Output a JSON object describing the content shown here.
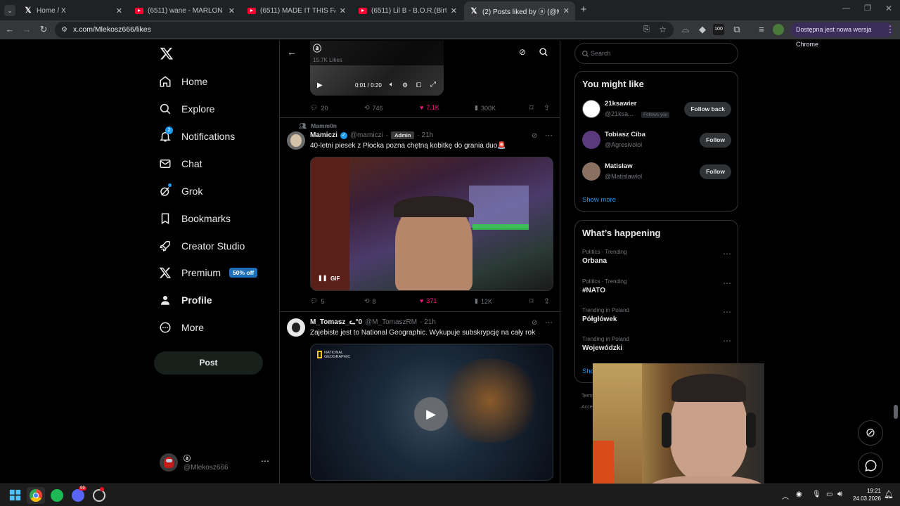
{
  "browser": {
    "tabs": [
      {
        "title": "Home / X",
        "icon": "x-logo"
      },
      {
        "title": "(6511) wane - MARLON BRANDO",
        "icon": "youtube"
      },
      {
        "title": "(6511) MADE IT THIS FAR / ...",
        "icon": "youtube"
      },
      {
        "title": "(6511) Lil B - B.O.R.(Birth Of Rap)",
        "icon": "youtube"
      },
      {
        "title": "(2) Posts liked by ⓐ (@Mlek",
        "icon": "x-logo",
        "active": true
      }
    ],
    "url": "x.com/Mlekosz666/likes",
    "update_label": "Dostępna jest nowa wersja Chrome",
    "extension_badge": "100"
  },
  "nav": {
    "items": [
      {
        "label": "Home",
        "icon": "home-icon"
      },
      {
        "label": "Explore",
        "icon": "search-icon"
      },
      {
        "label": "Notifications",
        "icon": "bell-icon",
        "badge": "2"
      },
      {
        "label": "Chat",
        "icon": "mail-icon"
      },
      {
        "label": "Grok",
        "icon": "grok-icon"
      },
      {
        "label": "Bookmarks",
        "icon": "bookmark-icon"
      },
      {
        "label": "Creator Studio",
        "icon": "rocket-icon"
      },
      {
        "label": "Premium",
        "icon": "x-logo-icon",
        "badge": "50% off"
      },
      {
        "label": "Profile",
        "icon": "person-icon"
      },
      {
        "label": "More",
        "icon": "more-circle-icon"
      }
    ],
    "post_label": "Post",
    "account": {
      "name": "ⓐ",
      "handle": "@Mlekosz666"
    }
  },
  "header": {
    "name": "ⓐ",
    "subtitle": "15.7K Likes"
  },
  "video_controls": {
    "time": "0:01 / 0:20"
  },
  "tweet0": {
    "replies": "20",
    "reposts": "746",
    "likes": "7.1K",
    "views": "300K"
  },
  "tweet1": {
    "context": "Mamm0n",
    "name": "Mamiczi",
    "handle": "@mamiczi",
    "badge": "Admin",
    "time": "· 21h",
    "text": "40-letni piesek z Płocka pozna chętną kobitkę do grania duo🚨",
    "media_tag": "GIF",
    "replies": "5",
    "reposts": "8",
    "likes": "371",
    "views": "12K"
  },
  "tweet2": {
    "name": "M_Tomasz_ᓚ°0",
    "handle": "@M_TomaszRM",
    "time": "· 21h",
    "text": "Zajebiste jest to National Geographic. Wykupuje subskrypcję na cały rok",
    "media_brand": "NATIONAL GEOGRAPHIC"
  },
  "search": {
    "placeholder": "Search"
  },
  "you_might_like": {
    "title": "You might like",
    "users": [
      {
        "name": "21ksawier",
        "handle": "@21ksa...",
        "note": "Follows you",
        "button": "Follow back"
      },
      {
        "name": "Tobiasz Ciba",
        "handle": "@Agresivolol",
        "button": "Follow"
      },
      {
        "name": "Matislaw",
        "handle": "@Matislawlol",
        "button": "Follow"
      }
    ],
    "show_more": "Show more"
  },
  "whats_happening": {
    "title": "What’s happening",
    "trends": [
      {
        "context": "Politics · Trending",
        "name": "Orbana"
      },
      {
        "context": "Politics · Trending",
        "name": "#NATO"
      },
      {
        "context": "Trending in Poland",
        "name": "Półgłówek"
      },
      {
        "context": "Trending in Poland",
        "name": "Wojewódzki"
      }
    ],
    "show_more_partial": "Sho"
  },
  "footer_partial": {
    "terms": "Term",
    "access": "Acce"
  },
  "taskbar": {
    "time": "19:21",
    "date": "24.03.2026"
  }
}
